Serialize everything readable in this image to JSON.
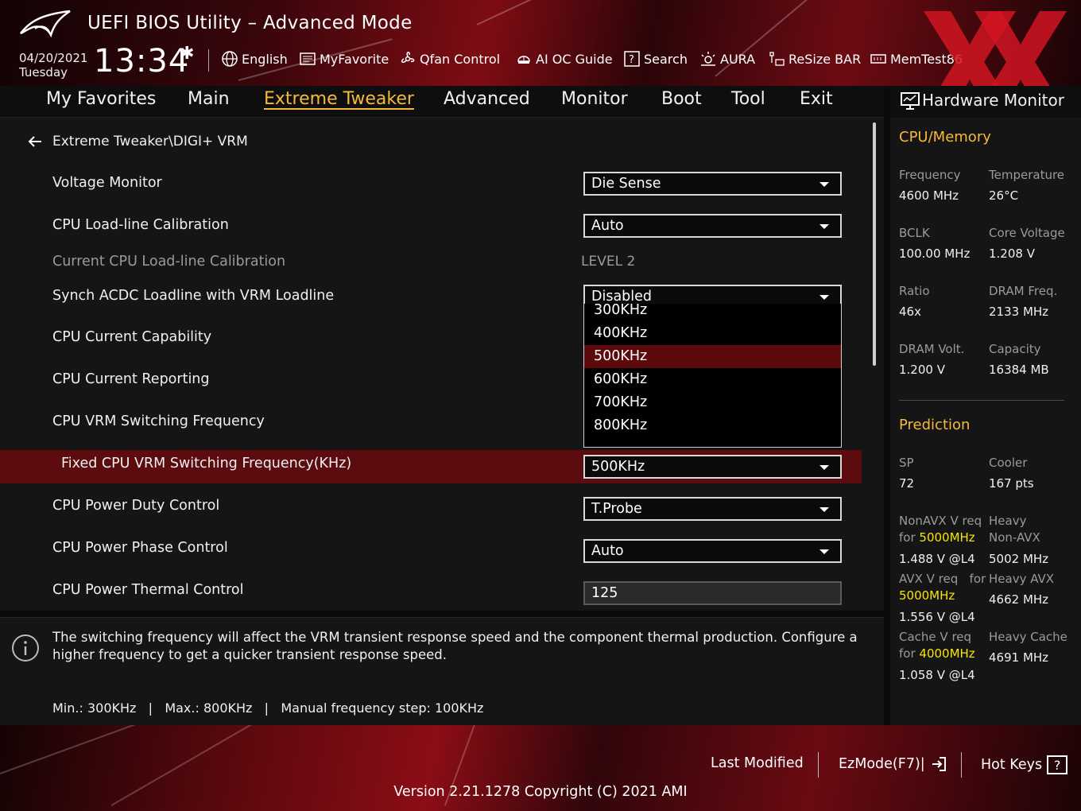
{
  "header": {
    "title": "UEFI BIOS Utility – Advanced Mode",
    "date": "04/20/2021",
    "day": "Tuesday",
    "time": "13:34",
    "tools": [
      {
        "label": "English",
        "icon": "globe-icon"
      },
      {
        "label": "MyFavorite",
        "icon": "favorite-icon"
      },
      {
        "label": "Qfan Control",
        "icon": "fan-icon"
      },
      {
        "label": "AI OC Guide",
        "icon": "ai-oc-guide-icon"
      },
      {
        "label": "Search",
        "icon": "search-icon"
      },
      {
        "label": "AURA",
        "icon": "aura-icon"
      },
      {
        "label": "ReSize BAR",
        "icon": "resize-bar-icon"
      },
      {
        "label": "MemTest86",
        "icon": "memtest-icon"
      }
    ]
  },
  "nav": {
    "tabs": [
      "My Favorites",
      "Main",
      "Extreme Tweaker",
      "Advanced",
      "Monitor",
      "Boot",
      "Tool",
      "Exit"
    ],
    "active": "Extreme Tweaker"
  },
  "breadcrumb": "Extreme Tweaker\\DIGI+ VRM",
  "settings": [
    {
      "label": "Voltage Monitor",
      "value": "Die Sense"
    },
    {
      "label": "CPU Load-line Calibration",
      "value": "Auto"
    },
    {
      "label": "Current CPU Load-line Calibration",
      "value": "LEVEL 2"
    },
    {
      "label": "Synch ACDC Loadline with VRM Loadline",
      "value": "Disabled"
    },
    {
      "label": "CPU Current Capability",
      "value": ""
    },
    {
      "label": "CPU Current Reporting",
      "value": ""
    },
    {
      "label": "CPU VRM Switching Frequency",
      "value": ""
    },
    {
      "label": "Fixed CPU VRM Switching Frequency(KHz)",
      "value": "500KHz"
    },
    {
      "label": "CPU Power Duty Control",
      "value": "T.Probe"
    },
    {
      "label": "CPU Power Phase Control",
      "value": "Auto"
    },
    {
      "label": "CPU Power Thermal Control",
      "value": "125"
    }
  ],
  "dropdown": {
    "options": [
      "300KHz",
      "400KHz",
      "500KHz",
      "600KHz",
      "700KHz",
      "800KHz"
    ],
    "selected": "500KHz"
  },
  "help": {
    "text": "The switching frequency will affect the VRM transient response speed and the component thermal production. Configure a higher frequency to get a quicker transient response speed.",
    "limits": "Min.: 300KHz   |   Max.: 800KHz   |   Manual frequency step: 100KHz"
  },
  "hardware_monitor": {
    "title": "Hardware Monitor",
    "cpu_memory": {
      "heading": "CPU/Memory",
      "frequency_label": "Frequency",
      "frequency": "4600 MHz",
      "temperature_label": "Temperature",
      "temperature": "26°C",
      "bclk_label": "BCLK",
      "bclk": "100.00 MHz",
      "core_voltage_label": "Core Voltage",
      "core_voltage": "1.208 V",
      "ratio_label": "Ratio",
      "ratio": "46x",
      "dram_freq_label": "DRAM Freq.",
      "dram_freq": "2133 MHz",
      "dram_volt_label": "DRAM Volt.",
      "dram_volt": "1.200 V",
      "capacity_label": "Capacity",
      "capacity": "16384 MB"
    },
    "prediction": {
      "heading": "Prediction",
      "sp_label": "SP",
      "sp": "72",
      "cooler_label": "Cooler",
      "cooler": "167 pts",
      "nonavx_req_label": "NonAVX V req",
      "nonavx_for": "for",
      "nonavx_freq": "5000MHz",
      "nonavx_value": "1.488 V @L4",
      "heavy_nonavx_label_1": "Heavy",
      "heavy_nonavx_label_2": "Non-AVX",
      "heavy_nonavx": "5002 MHz",
      "avx_req_label": "AVX V req",
      "avx_for": "for",
      "avx_freq": "5000MHz",
      "avx_value": "1.556 V @L4",
      "heavy_avx_label": "Heavy AVX",
      "heavy_avx": "4662 MHz",
      "cache_req_label": "Cache V req",
      "cache_for": "for",
      "cache_freq": "4000MHz",
      "cache_value": "1.058 V @L4",
      "heavy_cache_label": "Heavy Cache",
      "heavy_cache": "4691 MHz"
    }
  },
  "footer": {
    "last_modified": "Last Modified",
    "ezmode": "EzMode(F7)|",
    "hotkeys": "Hot Keys",
    "hotkeys_key": "?",
    "version": "Version 2.21.1278 Copyright (C) 2021 AMI"
  },
  "colors": {
    "accent": "#f6b93a",
    "highlight_row": "#5c0b0e",
    "prediction_highlight": "#f6e600"
  }
}
